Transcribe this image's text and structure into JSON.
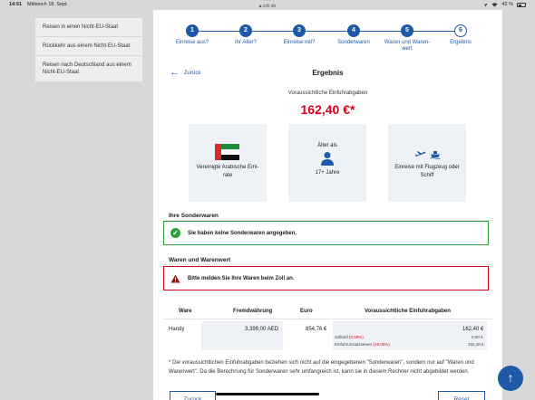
{
  "status_bar": {
    "time": "14:51",
    "date": "Mittwoch 18. Sept.",
    "url": "zoll.de",
    "battery": "42 %"
  },
  "sidebar": {
    "items": [
      {
        "label": "Reisen in einen Nicht-EU-Staat"
      },
      {
        "label": "Rückkehr aus einem Nicht-EU-Staat"
      },
      {
        "label": "Reisen nach Deutschland aus einem Nicht-EU-Staat"
      }
    ]
  },
  "steps": [
    {
      "number": "1",
      "label": "Einreise aus?"
    },
    {
      "number": "2",
      "label": "Ihr Alter?"
    },
    {
      "number": "3",
      "label": "Einreise mit?"
    },
    {
      "number": "4",
      "label": "Sonderwaren"
    },
    {
      "number": "5",
      "label": "Waren und Waren-wert"
    },
    {
      "number": "6",
      "label": "Ergebnis"
    }
  ],
  "result": {
    "back_label": "Zurück",
    "title": "Ergebnis",
    "estimate_label": "Voraussichtliche Einfuhrabgaben",
    "amount": "162,40 €*"
  },
  "cards": {
    "country": "Vereinigte Arabische Emi-rate",
    "age_label": "Älter als",
    "age_value": "17+ Jahre",
    "travel": "Einreise mit Flugzeug oder Schiff"
  },
  "sonderwaren": {
    "heading": "Ihre Sonderwaren",
    "message": "Sie haben keine Sonderwaren angegeben."
  },
  "waren": {
    "heading": "Waren und Warenwert",
    "message": "Bitte melden Sie Ihre Waren beim Zoll an."
  },
  "table": {
    "headers": [
      "Ware",
      "Fremdwährung",
      "Euro",
      "Voraussichtliche Einfuhrabgaben"
    ],
    "row": {
      "ware": "Handy",
      "foreign": "3.399,00 AED",
      "euro": "854,76 €",
      "total": "162,40 €",
      "zolltarif_label": "Zolltarif",
      "zolltarif_rate": "(0,00%)",
      "zolltarif_value": "0,00 €",
      "ust_label": "Einfuhrumsatzsteuer",
      "ust_rate": "(19,00%)",
      "ust_value": "162,40 €"
    }
  },
  "footnote": "* Die voraussichtlichen Einfuhrabgaben beziehen sich nicht auf die eingegebenen \"Sonderwaren\", sondern nur auf \"Waren und Warenwert\". Da die Berechnung für Sonderwaren sehr umfangreich ist, kann sie in diesem Rechner nicht abgebildet werden.",
  "buttons": {
    "back": "Zurück",
    "reset": "Reset"
  },
  "colors": {
    "accent": "#1e5aa8",
    "danger": "#d6001c",
    "success": "#2e9e3e"
  }
}
